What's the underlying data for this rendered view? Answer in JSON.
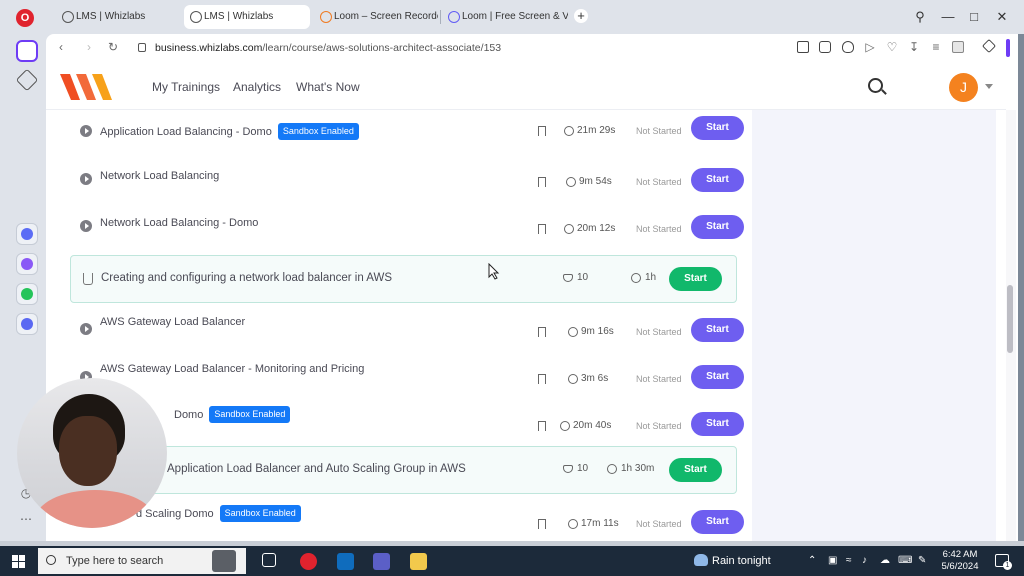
{
  "browser": {
    "tabs": [
      {
        "label": "LMS | Whizlabs"
      },
      {
        "label": "LMS | Whizlabs"
      },
      {
        "label": "Loom – Screen Recorder /"
      },
      {
        "label": "Loom | Free Screen & Vide"
      }
    ],
    "url_domain": "business.whizlabs.com",
    "url_path": "/learn/course/aws-solutions-architect-associate/153",
    "new_tab_label": "+"
  },
  "header": {
    "nav": [
      "My Trainings",
      "Analytics",
      "What's Now"
    ],
    "avatar_initial": "J"
  },
  "lessons": [
    {
      "title": "Application Load Balancing - Domo",
      "badge": "Sandbox Enabled",
      "duration": "21m 29s",
      "status": "Not Started",
      "action": "Start"
    },
    {
      "title": "Network Load Balancing",
      "badge": "",
      "duration": "9m 54s",
      "status": "Not Started",
      "action": "Start"
    },
    {
      "title": "Network Load Balancing - Domo",
      "badge": "",
      "duration": "20m 12s",
      "status": "Not Started",
      "action": "Start"
    },
    {
      "lab": true,
      "title": "Creating and configuring a network load balancer in AWS",
      "points": "10",
      "duration": "1h",
      "action": "Start"
    },
    {
      "title": "AWS Gateway Load Balancer",
      "badge": "",
      "duration": "9m 16s",
      "status": "Not Started",
      "action": "Start"
    },
    {
      "title": "AWS Gateway Load Balancer - Monitoring and Pricing",
      "badge": "",
      "duration": "3m 6s",
      "status": "Not Started",
      "action": "Start"
    },
    {
      "title": "Domo",
      "badge": "Sandbox Enabled",
      "duration": "20m 40s",
      "status": "Not Started",
      "action": "Start"
    },
    {
      "lab": true,
      "title": "Application Load Balancer and Auto Scaling Group in AWS",
      "points": "10",
      "duration": "1h 30m",
      "action": "Start"
    },
    {
      "title": "d Scaling Domo",
      "badge": "Sandbox Enabled",
      "duration": "17m 11s",
      "status": "Not Started",
      "action": "Start"
    }
  ],
  "taskbar": {
    "search_placeholder": "Type here to search",
    "weather": "Rain tonight",
    "time": "6:42 AM",
    "date": "5/6/2024",
    "notification_count": "1"
  },
  "colors": {
    "start_purple": "#6e5ef0",
    "start_green": "#11b86b",
    "sandbox_badge": "#1479f7",
    "avatar": "#f4821f",
    "opera_accent": "#6e3cf5"
  }
}
